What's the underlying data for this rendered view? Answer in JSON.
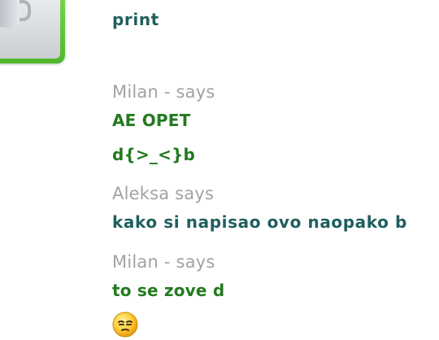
{
  "messages": [
    {
      "text": "print"
    },
    {
      "sender": "Milan - says",
      "lines": [
        "AE OPET",
        "d{>_<}b"
      ]
    },
    {
      "sender": "Aleksa says",
      "lines": [
        "kako si napisao ovo naopako b"
      ]
    },
    {
      "sender": "Milan - says",
      "lines": [
        "to se zove d"
      ]
    }
  ],
  "icons": {
    "avatar": "coffee-mug-avatar-icon",
    "emoticon": "sleepy-face-icon"
  },
  "colors": {
    "sender_gray": "#a2a2a2",
    "text_teal": "#1f5f5f",
    "text_green": "#237a1f",
    "avatar_frame_green": "#5fc436",
    "emoticon_yellow": "#ffcc33"
  }
}
